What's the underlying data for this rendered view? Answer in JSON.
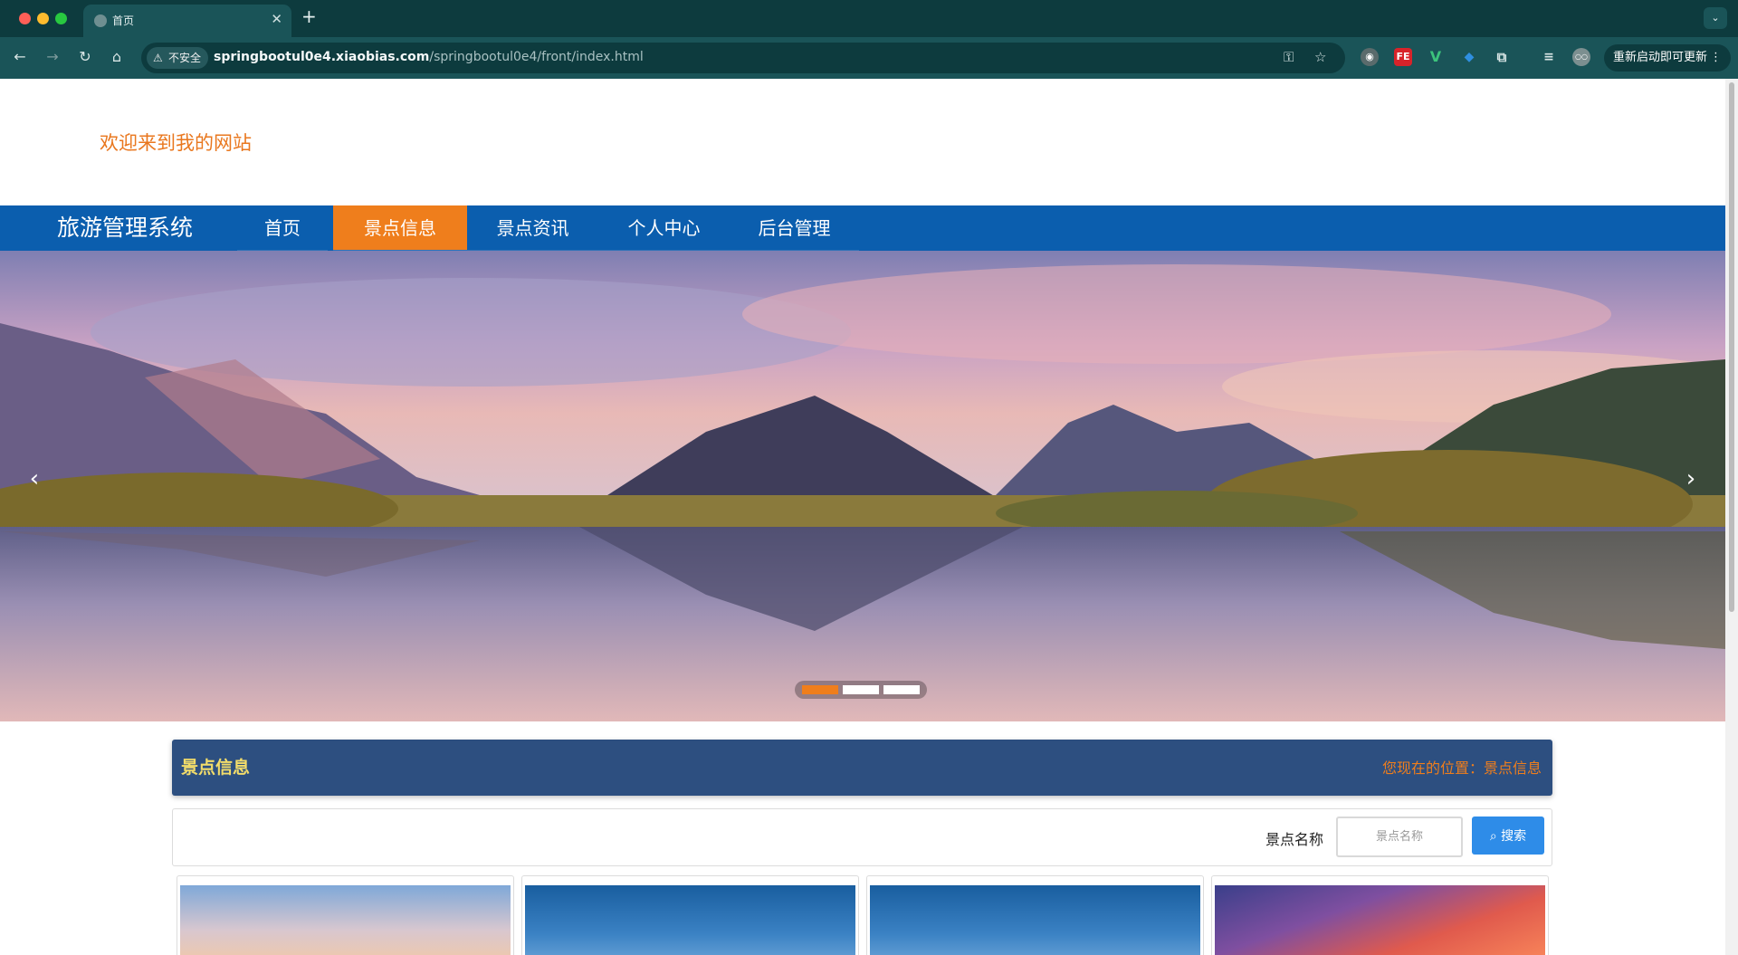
{
  "browser": {
    "tab_title": "首页",
    "security_label": "不安全",
    "url_host": "springbootul0e4.xiaobias.com",
    "url_path": "/springbootul0e4/front/index.html",
    "update_button": "重新启动即可更新"
  },
  "site": {
    "welcome": "欢迎来到我的网站",
    "brand": "旅游管理系统"
  },
  "nav": [
    {
      "label": "首页",
      "active": false
    },
    {
      "label": "景点信息",
      "active": true
    },
    {
      "label": "景点资讯",
      "active": false
    },
    {
      "label": "个人中心",
      "active": false
    },
    {
      "label": "后台管理",
      "active": false
    }
  ],
  "carousel": {
    "slide_count": 3,
    "active_index": 0
  },
  "section": {
    "title": "景点信息",
    "location": "您现在的位置：景点信息"
  },
  "search": {
    "label": "景点名称",
    "placeholder": "景点名称",
    "button": "搜索"
  },
  "cards": [
    {
      "image": "city-sunset"
    },
    {
      "image": "blue-sky"
    },
    {
      "image": "blue-sky"
    },
    {
      "image": "red-clouds"
    }
  ]
}
